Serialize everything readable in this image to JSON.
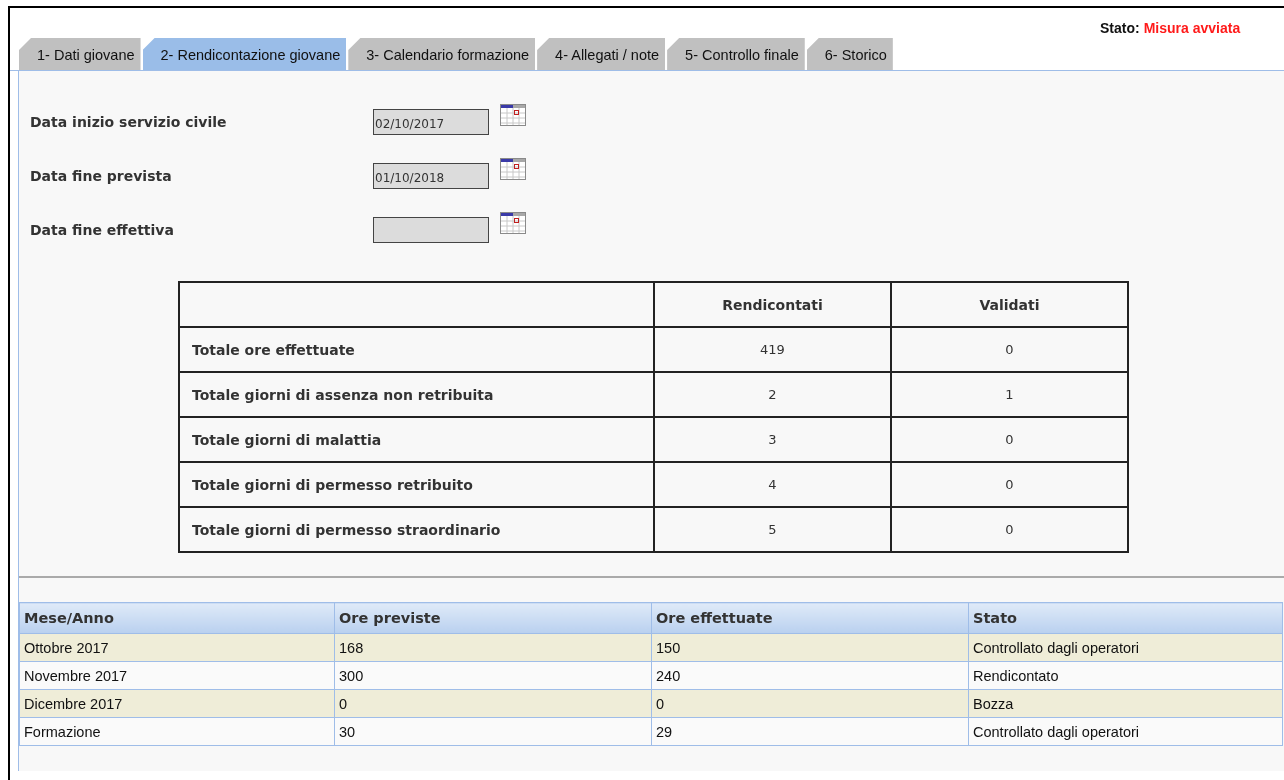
{
  "status": {
    "label": "Stato:",
    "value": "Misura avviata"
  },
  "tabs": [
    {
      "label": "1- Dati giovane",
      "selected": false
    },
    {
      "label": "2- Rendicontazione giovane",
      "selected": true
    },
    {
      "label": "3- Calendario formazione",
      "selected": false
    },
    {
      "label": "4- Allegati / note",
      "selected": false
    },
    {
      "label": "5- Controllo finale",
      "selected": false
    },
    {
      "label": "6- Storico",
      "selected": false
    }
  ],
  "fields": [
    {
      "label": "Data inizio servizio civile",
      "value": "02/10/2017"
    },
    {
      "label": "Data fine prevista",
      "value": "01/10/2018"
    },
    {
      "label": "Data fine effettiva"
    }
  ],
  "summary": {
    "columns": [
      "Rendicontati",
      "Validati"
    ],
    "rows": [
      {
        "label": "Totale ore effettuate",
        "values": [
          "419",
          "0"
        ]
      },
      {
        "label": "Totale giorni di assenza non retribuita",
        "values": [
          "2",
          "1"
        ]
      },
      {
        "label": "Totale giorni di malattia",
        "values": [
          "3",
          "0"
        ]
      },
      {
        "label": "Totale giorni di permesso retribuito",
        "values": [
          "4",
          "0"
        ]
      },
      {
        "label": "Totale giorni di permesso straordinario",
        "values": [
          "5",
          "0"
        ]
      }
    ]
  },
  "grid": {
    "columns": [
      "Mese/Anno",
      "Ore previste",
      "Ore effettuate",
      "Stato"
    ],
    "rows": [
      [
        "Ottobre 2017",
        "168",
        "150",
        "Controllato dagli operatori"
      ],
      [
        "Novembre 2017",
        "300",
        "240",
        "Rendicontato"
      ],
      [
        "Dicembre 2017",
        "0",
        "0",
        "Bozza"
      ],
      [
        "Formazione",
        "30",
        "29",
        "Controllato dagli operatori"
      ]
    ]
  }
}
